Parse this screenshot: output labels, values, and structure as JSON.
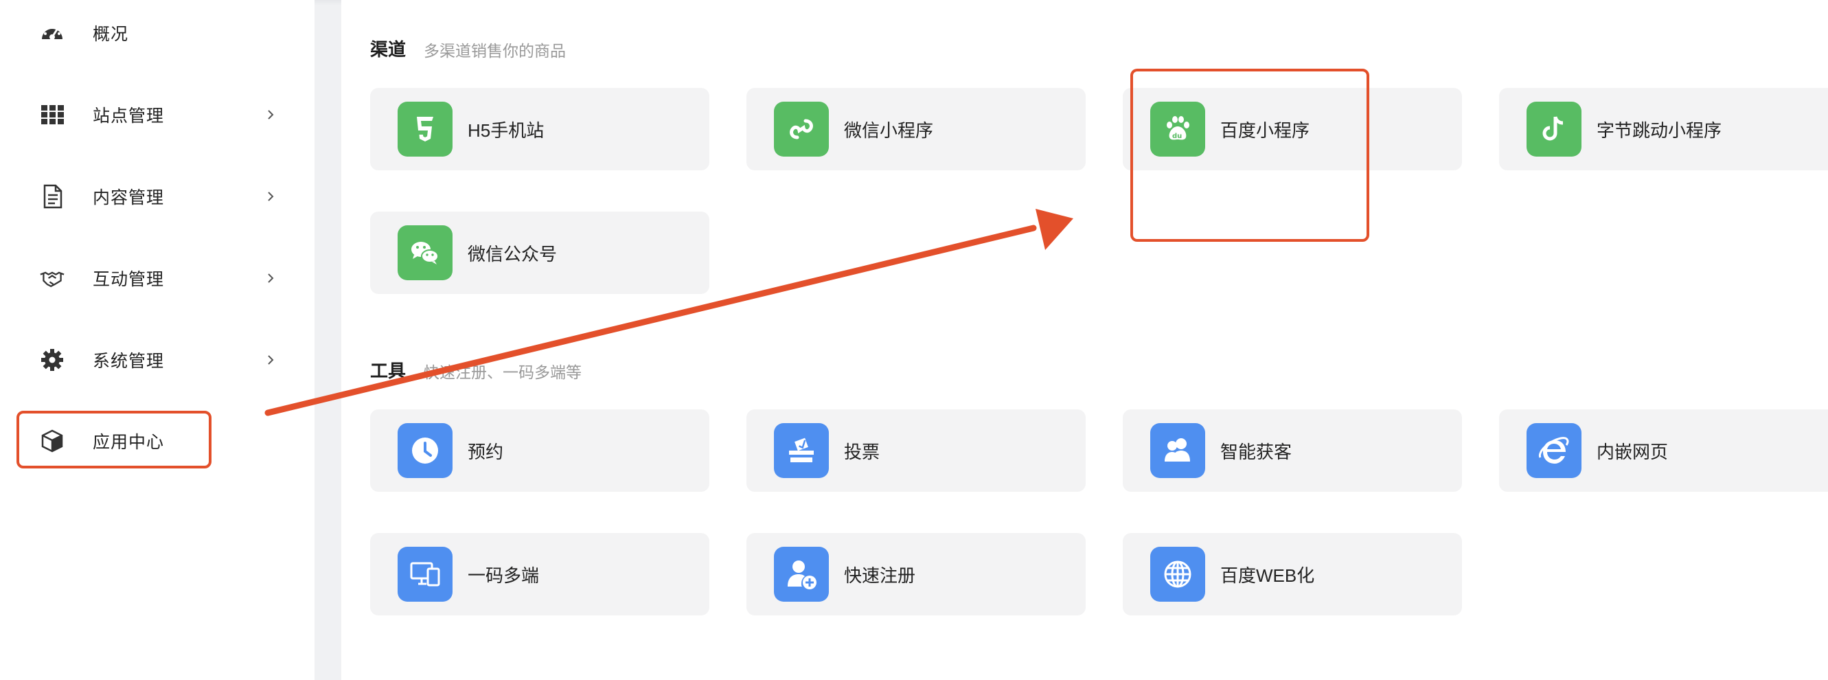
{
  "sidebar": {
    "items": [
      {
        "label": "概况",
        "icon": "dashboard-icon",
        "has_arrow": false
      },
      {
        "label": "站点管理",
        "icon": "grid-icon",
        "has_arrow": true
      },
      {
        "label": "内容管理",
        "icon": "document-icon",
        "has_arrow": true
      },
      {
        "label": "互动管理",
        "icon": "handshake-icon",
        "has_arrow": true
      },
      {
        "label": "系统管理",
        "icon": "gear-icon",
        "has_arrow": true
      },
      {
        "label": "应用中心",
        "icon": "cube-icon",
        "has_arrow": false,
        "active": true
      }
    ]
  },
  "channels": {
    "title": "渠道",
    "subtitle": "多渠道销售你的商品",
    "items": [
      {
        "label": "H5手机站",
        "icon": "html5-icon",
        "color": "#58bc63"
      },
      {
        "label": "微信小程序",
        "icon": "wechat-miniprogram-icon",
        "color": "#58bc63"
      },
      {
        "label": "百度小程序",
        "icon": "baidu-paw-icon",
        "color": "#58bc63"
      },
      {
        "label": "字节跳动小程序",
        "icon": "tiktok-note-icon",
        "color": "#58bc63"
      },
      {
        "label": "微信公众号",
        "icon": "wechat-chat-icon",
        "color": "#58bc63"
      }
    ]
  },
  "tools": {
    "title": "工具",
    "subtitle": "快速注册、一码多端等",
    "items": [
      {
        "label": "预约",
        "icon": "clock-icon",
        "color": "#4f8ff0"
      },
      {
        "label": "投票",
        "icon": "ballot-box-icon",
        "color": "#4f8ff0"
      },
      {
        "label": "智能获客",
        "icon": "users-icon",
        "color": "#4f8ff0"
      },
      {
        "label": "内嵌网页",
        "icon": "ie-browser-icon",
        "color": "#4f8ff0"
      },
      {
        "label": "一码多端",
        "icon": "devices-icon",
        "color": "#4f8ff0"
      },
      {
        "label": "快速注册",
        "icon": "add-user-icon",
        "color": "#4f8ff0"
      },
      {
        "label": "百度WEB化",
        "icon": "globe-icon",
        "color": "#4f8ff0"
      }
    ]
  },
  "annotation_color": "#e3502b"
}
